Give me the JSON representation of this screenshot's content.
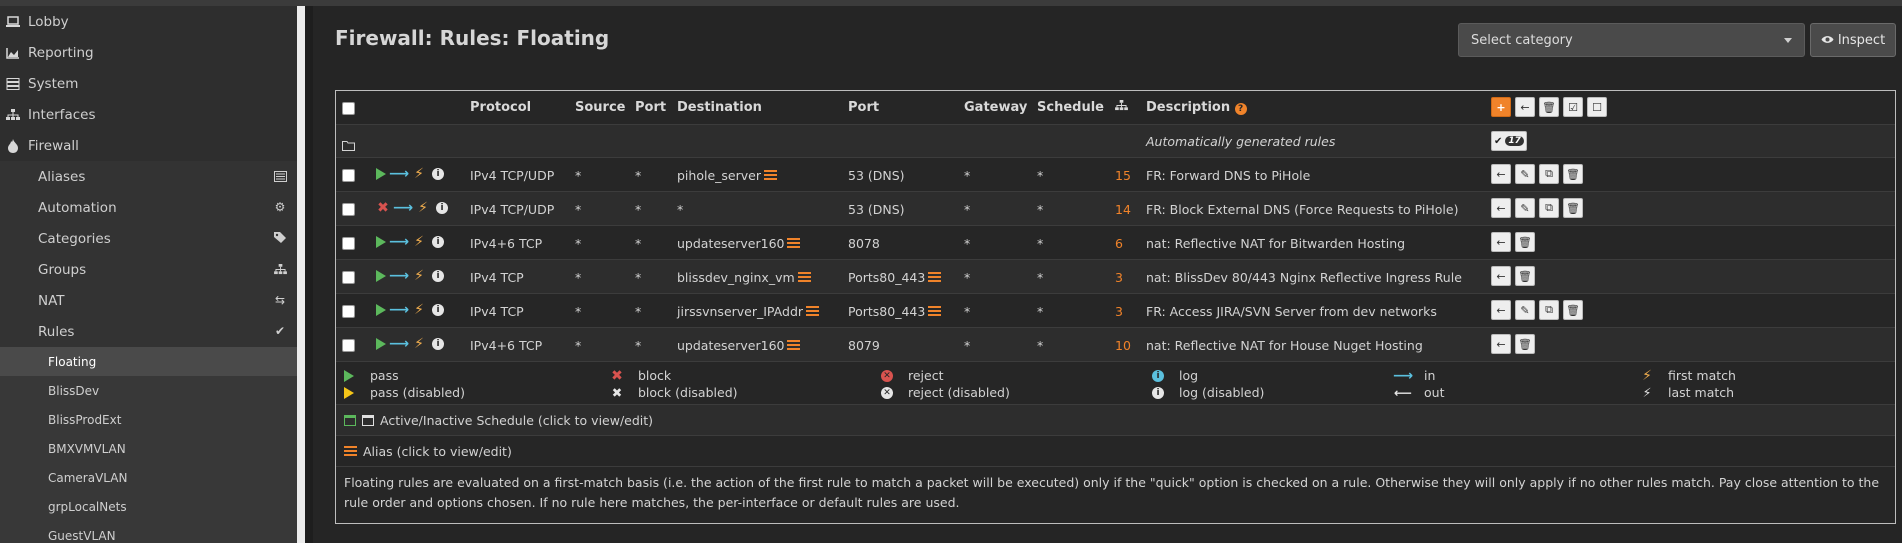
{
  "sidebar": {
    "top": [
      {
        "label": "Lobby",
        "icon": "laptop-icon"
      },
      {
        "label": "Reporting",
        "icon": "area-chart-icon"
      },
      {
        "label": "System",
        "icon": "server-icon"
      },
      {
        "label": "Interfaces",
        "icon": "sitemap-icon"
      },
      {
        "label": "Firewall",
        "icon": "fire-icon"
      }
    ],
    "firewall": [
      {
        "label": "Aliases",
        "icon": "list-icon"
      },
      {
        "label": "Automation",
        "icon": "cog-icon"
      },
      {
        "label": "Categories",
        "icon": "tags-icon"
      },
      {
        "label": "Groups",
        "icon": "sitemap-icon"
      },
      {
        "label": "NAT",
        "icon": "exchange-icon"
      },
      {
        "label": "Rules",
        "icon": "check-icon"
      }
    ],
    "rules": [
      "Floating",
      "BlissDev",
      "BlissProdExt",
      "BMXVMVLAN",
      "CameraVLAN",
      "grpLocalNets",
      "GuestVLAN"
    ]
  },
  "page": {
    "title": "Firewall: Rules: Floating",
    "category_placeholder": "Select category",
    "inspect_label": "Inspect"
  },
  "table": {
    "headers": {
      "protocol": "Protocol",
      "source": "Source",
      "port": "Port",
      "destination": "Destination",
      "dport": "Port",
      "gateway": "Gateway",
      "schedule": "Schedule",
      "description": "Description"
    },
    "auto_label": "Automatically generated rules",
    "auto_count": "17",
    "rows": [
      {
        "action": "pass",
        "protocol": "IPv4 TCP/UDP",
        "source": "*",
        "port": "*",
        "destination": "pihole_server",
        "dest_alias": true,
        "dport": "53 (DNS)",
        "dport_alias": false,
        "gateway": "*",
        "schedule": "*",
        "count": "15",
        "description": "FR: Forward DNS to PiHole",
        "full_buttons": true
      },
      {
        "action": "block",
        "protocol": "IPv4 TCP/UDP",
        "source": "*",
        "port": "*",
        "destination": "*",
        "dest_alias": false,
        "dport": "53 (DNS)",
        "dport_alias": false,
        "gateway": "*",
        "schedule": "*",
        "count": "14",
        "description": "FR: Block External DNS (Force Requests to PiHole)",
        "full_buttons": true
      },
      {
        "action": "pass",
        "protocol": "IPv4+6 TCP",
        "source": "*",
        "port": "*",
        "destination": "updateserver160",
        "dest_alias": true,
        "dport": "8078",
        "dport_alias": false,
        "gateway": "*",
        "schedule": "*",
        "count": "6",
        "description": "nat: Reflective NAT for Bitwarden Hosting",
        "full_buttons": false
      },
      {
        "action": "pass",
        "protocol": "IPv4 TCP",
        "source": "*",
        "port": "*",
        "destination": "blissdev_nginx_vm",
        "dest_alias": true,
        "dport": "Ports80_443",
        "dport_alias": true,
        "gateway": "*",
        "schedule": "*",
        "count": "3",
        "description": "nat: BlissDev 80/443 Nginx Reflective Ingress Rule",
        "full_buttons": false
      },
      {
        "action": "pass",
        "protocol": "IPv4 TCP",
        "source": "*",
        "port": "*",
        "destination": "jirssvnserver_IPAddr",
        "dest_alias": true,
        "dport": "Ports80_443",
        "dport_alias": true,
        "gateway": "*",
        "schedule": "*",
        "count": "3",
        "description": "FR: Access JIRA/SVN Server from dev networks",
        "full_buttons": true
      },
      {
        "action": "pass",
        "protocol": "IPv4+6 TCP",
        "source": "*",
        "port": "*",
        "destination": "updateserver160",
        "dest_alias": true,
        "dport": "8079",
        "dport_alias": false,
        "gateway": "*",
        "schedule": "*",
        "count": "10",
        "description": "nat: Reflective NAT for House Nuget Hosting",
        "full_buttons": false
      }
    ]
  },
  "legend": {
    "pass": "pass",
    "pass_disabled": "pass (disabled)",
    "block": "block",
    "block_disabled": "block (disabled)",
    "reject": "reject",
    "reject_disabled": "reject (disabled)",
    "log": "log",
    "log_disabled": "log (disabled)",
    "in": "in",
    "out": "out",
    "first_match": "first match",
    "last_match": "last match"
  },
  "info": {
    "schedule": "Active/Inactive Schedule (click to view/edit)",
    "alias": "Alias (click to view/edit)",
    "note": "Floating rules are evaluated on a first-match basis (i.e. the action of the first rule to match a packet will be executed) only if the \"quick\" option is checked on a rule. Otherwise they will only apply if no other rules match. Pay close attention to the rule order and options chosen. If no rule here matches, the per-interface or default rules are used."
  },
  "colors": {
    "accent": "#f0832a",
    "pass": "#5cb85c",
    "block": "#d9534f",
    "in": "#5bc0de"
  }
}
